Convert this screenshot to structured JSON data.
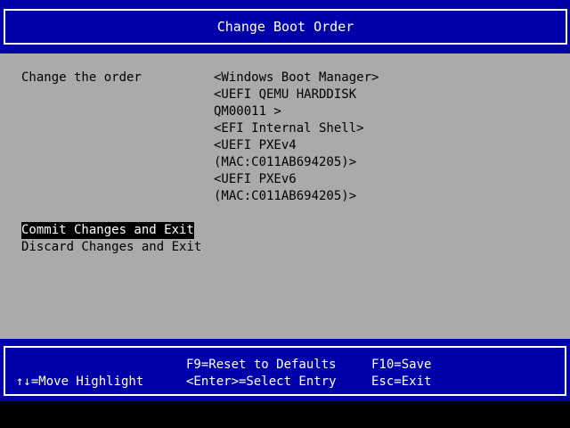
{
  "header": {
    "title": "Change Boot Order"
  },
  "main": {
    "order_label": "Change the order",
    "boot_order_lines": [
      "<Windows Boot Manager>",
      "<UEFI QEMU HARDDISK",
      "QM00011 >",
      "<EFI Internal Shell>",
      "<UEFI PXEv4",
      "(MAC:C011AB694205)>",
      "<UEFI PXEv6",
      "(MAC:C011AB694205)>"
    ],
    "actions": [
      {
        "label": "Commit Changes and Exit",
        "selected": true
      },
      {
        "label": "Discard Changes and Exit",
        "selected": false
      }
    ]
  },
  "footer": {
    "move_highlight": "↑↓=Move Highlight",
    "reset_defaults": "F9=Reset to Defaults",
    "select_entry": "<Enter>=Select Entry",
    "save": "F10=Save",
    "exit": "Esc=Exit"
  },
  "colors": {
    "bar_blue": "#0000aa",
    "panel_gray": "#aaaaaa",
    "text_white": "#ffffff",
    "text_black": "#000000",
    "highlight_bg": "#000000"
  }
}
